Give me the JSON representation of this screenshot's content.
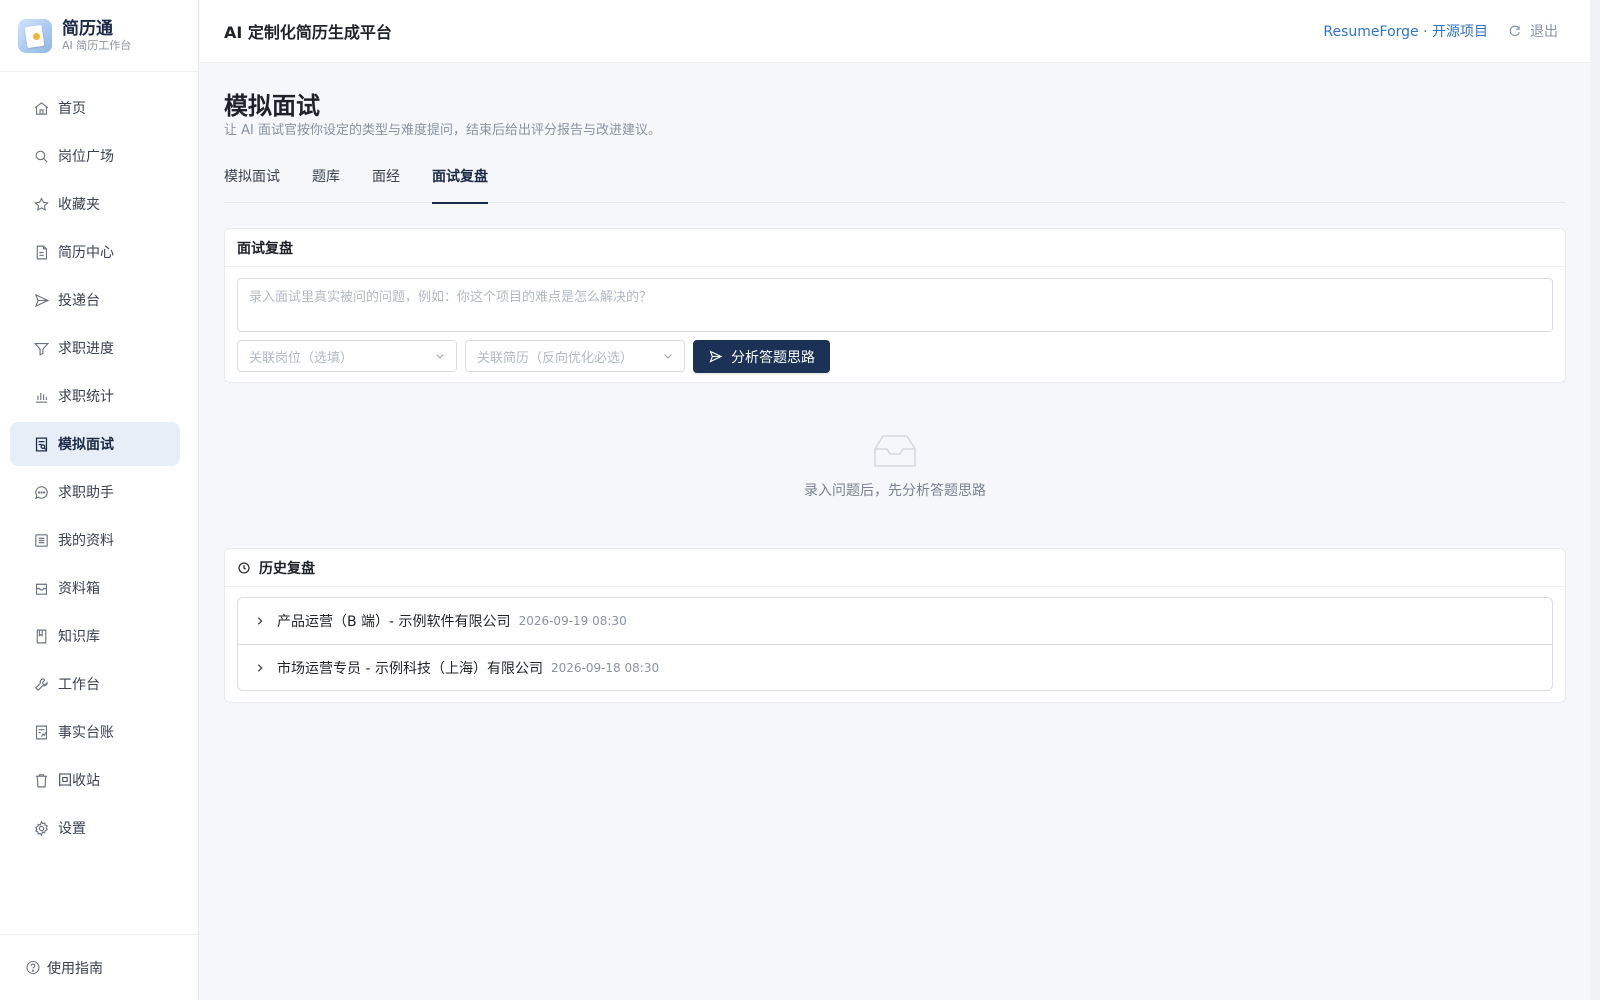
{
  "brand": {
    "name": "简历通",
    "subtitle": "AI 简历工作台"
  },
  "sidebar": {
    "items": [
      {
        "label": "首页",
        "icon": "home-icon"
      },
      {
        "label": "岗位广场",
        "icon": "search-icon"
      },
      {
        "label": "收藏夹",
        "icon": "star-icon"
      },
      {
        "label": "简历中心",
        "icon": "document-icon"
      },
      {
        "label": "投递台",
        "icon": "send-icon"
      },
      {
        "label": "求职进度",
        "icon": "filter-icon"
      },
      {
        "label": "求职统计",
        "icon": "bar-chart-icon"
      },
      {
        "label": "模拟面试",
        "icon": "interview-icon",
        "active": true
      },
      {
        "label": "求职助手",
        "icon": "chat-icon"
      },
      {
        "label": "我的资料",
        "icon": "profile-list-icon"
      },
      {
        "label": "资料箱",
        "icon": "inbox-icon"
      },
      {
        "label": "知识库",
        "icon": "book-icon"
      },
      {
        "label": "工作台",
        "icon": "wrench-icon"
      },
      {
        "label": "事实台账",
        "icon": "ledger-icon"
      },
      {
        "label": "回收站",
        "icon": "trash-icon"
      },
      {
        "label": "设置",
        "icon": "gear-icon"
      }
    ],
    "guide_label": "使用指南"
  },
  "header": {
    "title": "AI 定制化简历生成平台",
    "github_link": "ResumeForge · 开源项目",
    "logout_label": "退出"
  },
  "page": {
    "title": "模拟面试",
    "description": "让 AI 面试官按你设定的类型与难度提问，结束后给出评分报告与改进建议。"
  },
  "tabs": [
    {
      "label": "模拟面试",
      "active": false
    },
    {
      "label": "题库",
      "active": false
    },
    {
      "label": "面经",
      "active": false
    },
    {
      "label": "面试复盘",
      "active": true
    }
  ],
  "review": {
    "title": "面试复盘",
    "question_placeholder": "录入面试里真实被问的问题，例如：你这个项目的难点是怎么解决的？",
    "position_placeholder": "关联岗位（选填）",
    "resume_placeholder": "关联简历（反向优化必选）",
    "analyze_label": "分析答题思路"
  },
  "empty_state": {
    "text": "录入问题后，先分析答题思路"
  },
  "history": {
    "title": "历史复盘",
    "items": [
      {
        "title": "产品运营（B 端）- 示例软件有限公司",
        "date": "2026-09-19 08:30"
      },
      {
        "title": "市场运营专员 - 示例科技（上海）有限公司",
        "date": "2026-09-18 08:30"
      }
    ]
  },
  "colors": {
    "primary": "#1b3156",
    "link": "#2f74c8",
    "active_bg": "#e8eef8"
  }
}
